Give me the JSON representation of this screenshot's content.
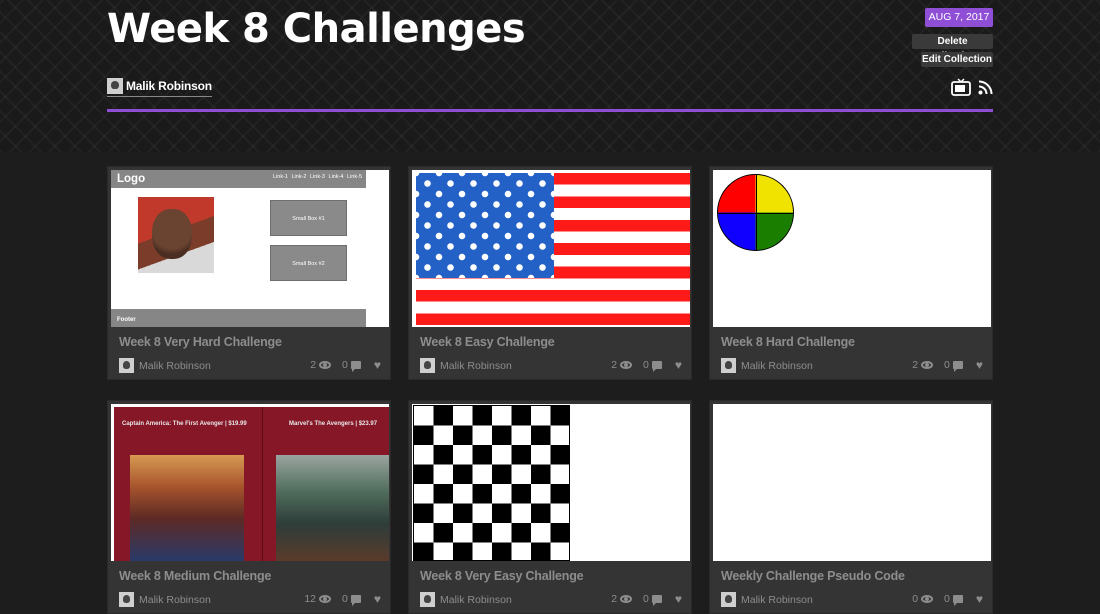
{
  "header": {
    "title": "Week 8 Challenges",
    "date": "AUG 7, 2017",
    "delete_label": "Delete Collection",
    "edit_label": "Edit Collection",
    "author": "Malik Robinson",
    "accent_color": "#8e4fd6"
  },
  "cards": [
    {
      "title": "Week 8 Very Hard Challenge",
      "author": "Malik Robinson",
      "views": "2",
      "comments": "0",
      "thumb": {
        "logo": "Logo",
        "links": "Link-1 Link-2 Link-3 Link-4 Link-5",
        "box1": "Small Box #1",
        "box2": "Small Box #2",
        "footer": "Footer"
      }
    },
    {
      "title": "Week 8 Easy Challenge",
      "author": "Malik Robinson",
      "views": "2",
      "comments": "0"
    },
    {
      "title": "Week 8 Hard Challenge",
      "author": "Malik Robinson",
      "views": "2",
      "comments": "0"
    },
    {
      "title": "Week 8 Medium Challenge",
      "author": "Malik Robinson",
      "views": "12",
      "comments": "0",
      "thumb": {
        "caption1": "Captain America: The First Avenger | $19.99",
        "caption2": "Marvel's The Avengers | $23.97"
      }
    },
    {
      "title": "Week 8 Very Easy Challenge",
      "author": "Malik Robinson",
      "views": "2",
      "comments": "0"
    },
    {
      "title": "Weekly Challenge Pseudo Code",
      "author": "Malik Robinson",
      "views": "0",
      "comments": "0"
    }
  ],
  "icons": {
    "tv": "tv-icon",
    "rss": "rss-icon",
    "eye": "eye-icon",
    "comment": "comment-icon",
    "heart": "heart-icon"
  }
}
